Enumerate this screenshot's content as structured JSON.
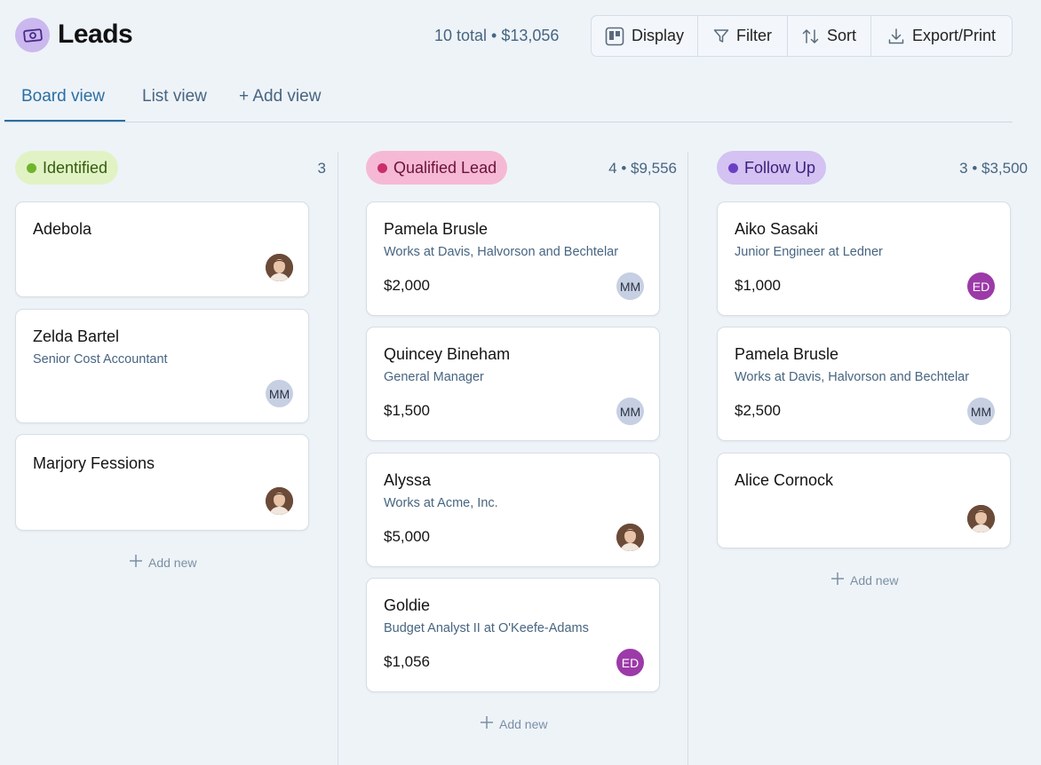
{
  "header": {
    "title": "Leads",
    "logo_icon": "camera-money-icon",
    "summary": "10 total • $13,056",
    "toolbar": {
      "display_label": "Display",
      "filter_label": "Filter",
      "sort_label": "Sort",
      "export_label": "Export/Print"
    }
  },
  "tabs": {
    "board": "Board view",
    "list": "List view",
    "add": "+ Add view"
  },
  "colors": {
    "identified_pill": "#e1f3c4",
    "identified_dot": "#6fb52c",
    "qualified_pill": "#f6b9d5",
    "qualified_dot": "#cc2d6b",
    "followup_pill": "#d3c2f2",
    "followup_dot": "#6b3fc4",
    "accent": "#2a6fa3"
  },
  "columns": {
    "identified": {
      "label": "Identified",
      "meta": "3",
      "add_new": "Add new",
      "cards": [
        {
          "name": "Adebola",
          "avatar": "photo"
        },
        {
          "name": "Zelda Bartel",
          "subtitle": "Senior Cost Accountant",
          "avatar": "MM"
        },
        {
          "name": "Marjory Fessions",
          "avatar": "photo"
        }
      ]
    },
    "qualified": {
      "label": "Qualified Lead",
      "meta": "4 • $9,556",
      "add_new": "Add new",
      "cards": [
        {
          "name": "Pamela Brusle",
          "subtitle": "Works at Davis, Halvorson and Bechtelar",
          "amount": "$2,000",
          "avatar": "MM"
        },
        {
          "name": "Quincey Bineham",
          "subtitle": "General Manager",
          "amount": "$1,500",
          "avatar": "MM"
        },
        {
          "name": "Alyssa",
          "subtitle": "Works at Acme, Inc.",
          "amount": "$5,000",
          "avatar": "photo"
        },
        {
          "name": "Goldie",
          "subtitle": "Budget Analyst II at O'Keefe-Adams",
          "amount": "$1,056",
          "avatar": "ED"
        }
      ]
    },
    "followup": {
      "label": "Follow Up",
      "meta": "3 • $3,500",
      "add_new": "Add new",
      "cards": [
        {
          "name": "Aiko Sasaki",
          "subtitle": "Junior Engineer at Ledner",
          "amount": "$1,000",
          "avatar": "ED"
        },
        {
          "name": "Pamela Brusle",
          "subtitle": "Works at Davis, Halvorson and Bechtelar",
          "amount": "$2,500",
          "avatar": "MM"
        },
        {
          "name": "Alice Cornock",
          "avatar": "photo"
        }
      ]
    }
  }
}
